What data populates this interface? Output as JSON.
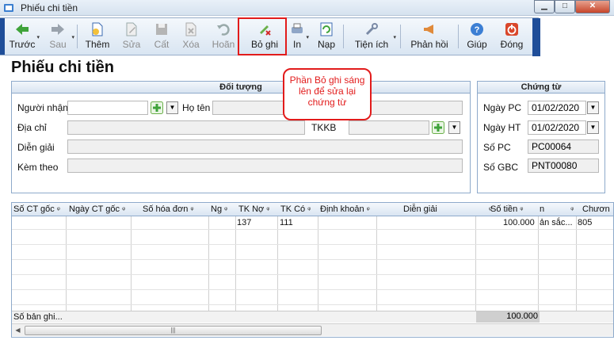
{
  "window": {
    "title": "Phiếu chi tiền"
  },
  "toolbar": {
    "back": "Trước",
    "next": "Sau",
    "add": "Thêm",
    "edit": "Sửa",
    "save": "Cất",
    "delete": "Xóa",
    "undo": "Hoãn",
    "discard": "Bỏ ghi",
    "print": "In",
    "load": "Nạp",
    "utilities": "Tiện ích",
    "feedback": "Phản hồi",
    "help": "Giúp",
    "close": "Đóng"
  },
  "page": {
    "title": "Phiếu chi tiền"
  },
  "callout": {
    "text": "Phần Bỏ ghi sáng lên để sửa lại chứng từ"
  },
  "doi_tuong": {
    "heading": "Đối tượng",
    "recipient_label": "Người nhận",
    "fullname_label": "Họ tên",
    "address_label": "Địa chỉ",
    "tkkb_label": "TKKB",
    "description_label": "Diễn giải",
    "attachment_label": "Kèm theo"
  },
  "chung_tu": {
    "heading": "Chứng từ",
    "ngay_pc_label": "Ngày PC",
    "ngay_pc": "01/02/2020",
    "ngay_ht_label": "Ngày HT",
    "ngay_ht": "01/02/2020",
    "so_pc_label": "Số PC",
    "so_pc": "PC00064",
    "so_gbc_label": "Số GBC",
    "so_gbc": "PNT00080"
  },
  "grid": {
    "columns": [
      "Số CT gốc",
      "Ngày CT gốc",
      "Số hóa đơn",
      "Ng",
      "TK Nợ",
      "TK Có",
      "Định khoản",
      "Diễn giải",
      "Số tiền",
      "n",
      "Chươn"
    ],
    "rows": [
      {
        "tk_no": "137",
        "tk_co": "111",
        "so_tien": "100.000",
        "n": "ản sắc...",
        "chuong": "805"
      }
    ],
    "footer_label": "Số bản ghi...",
    "footer_total": "100.000"
  },
  "colors": {
    "highlight": "#e21b1b",
    "accent": "#1f4e99"
  }
}
